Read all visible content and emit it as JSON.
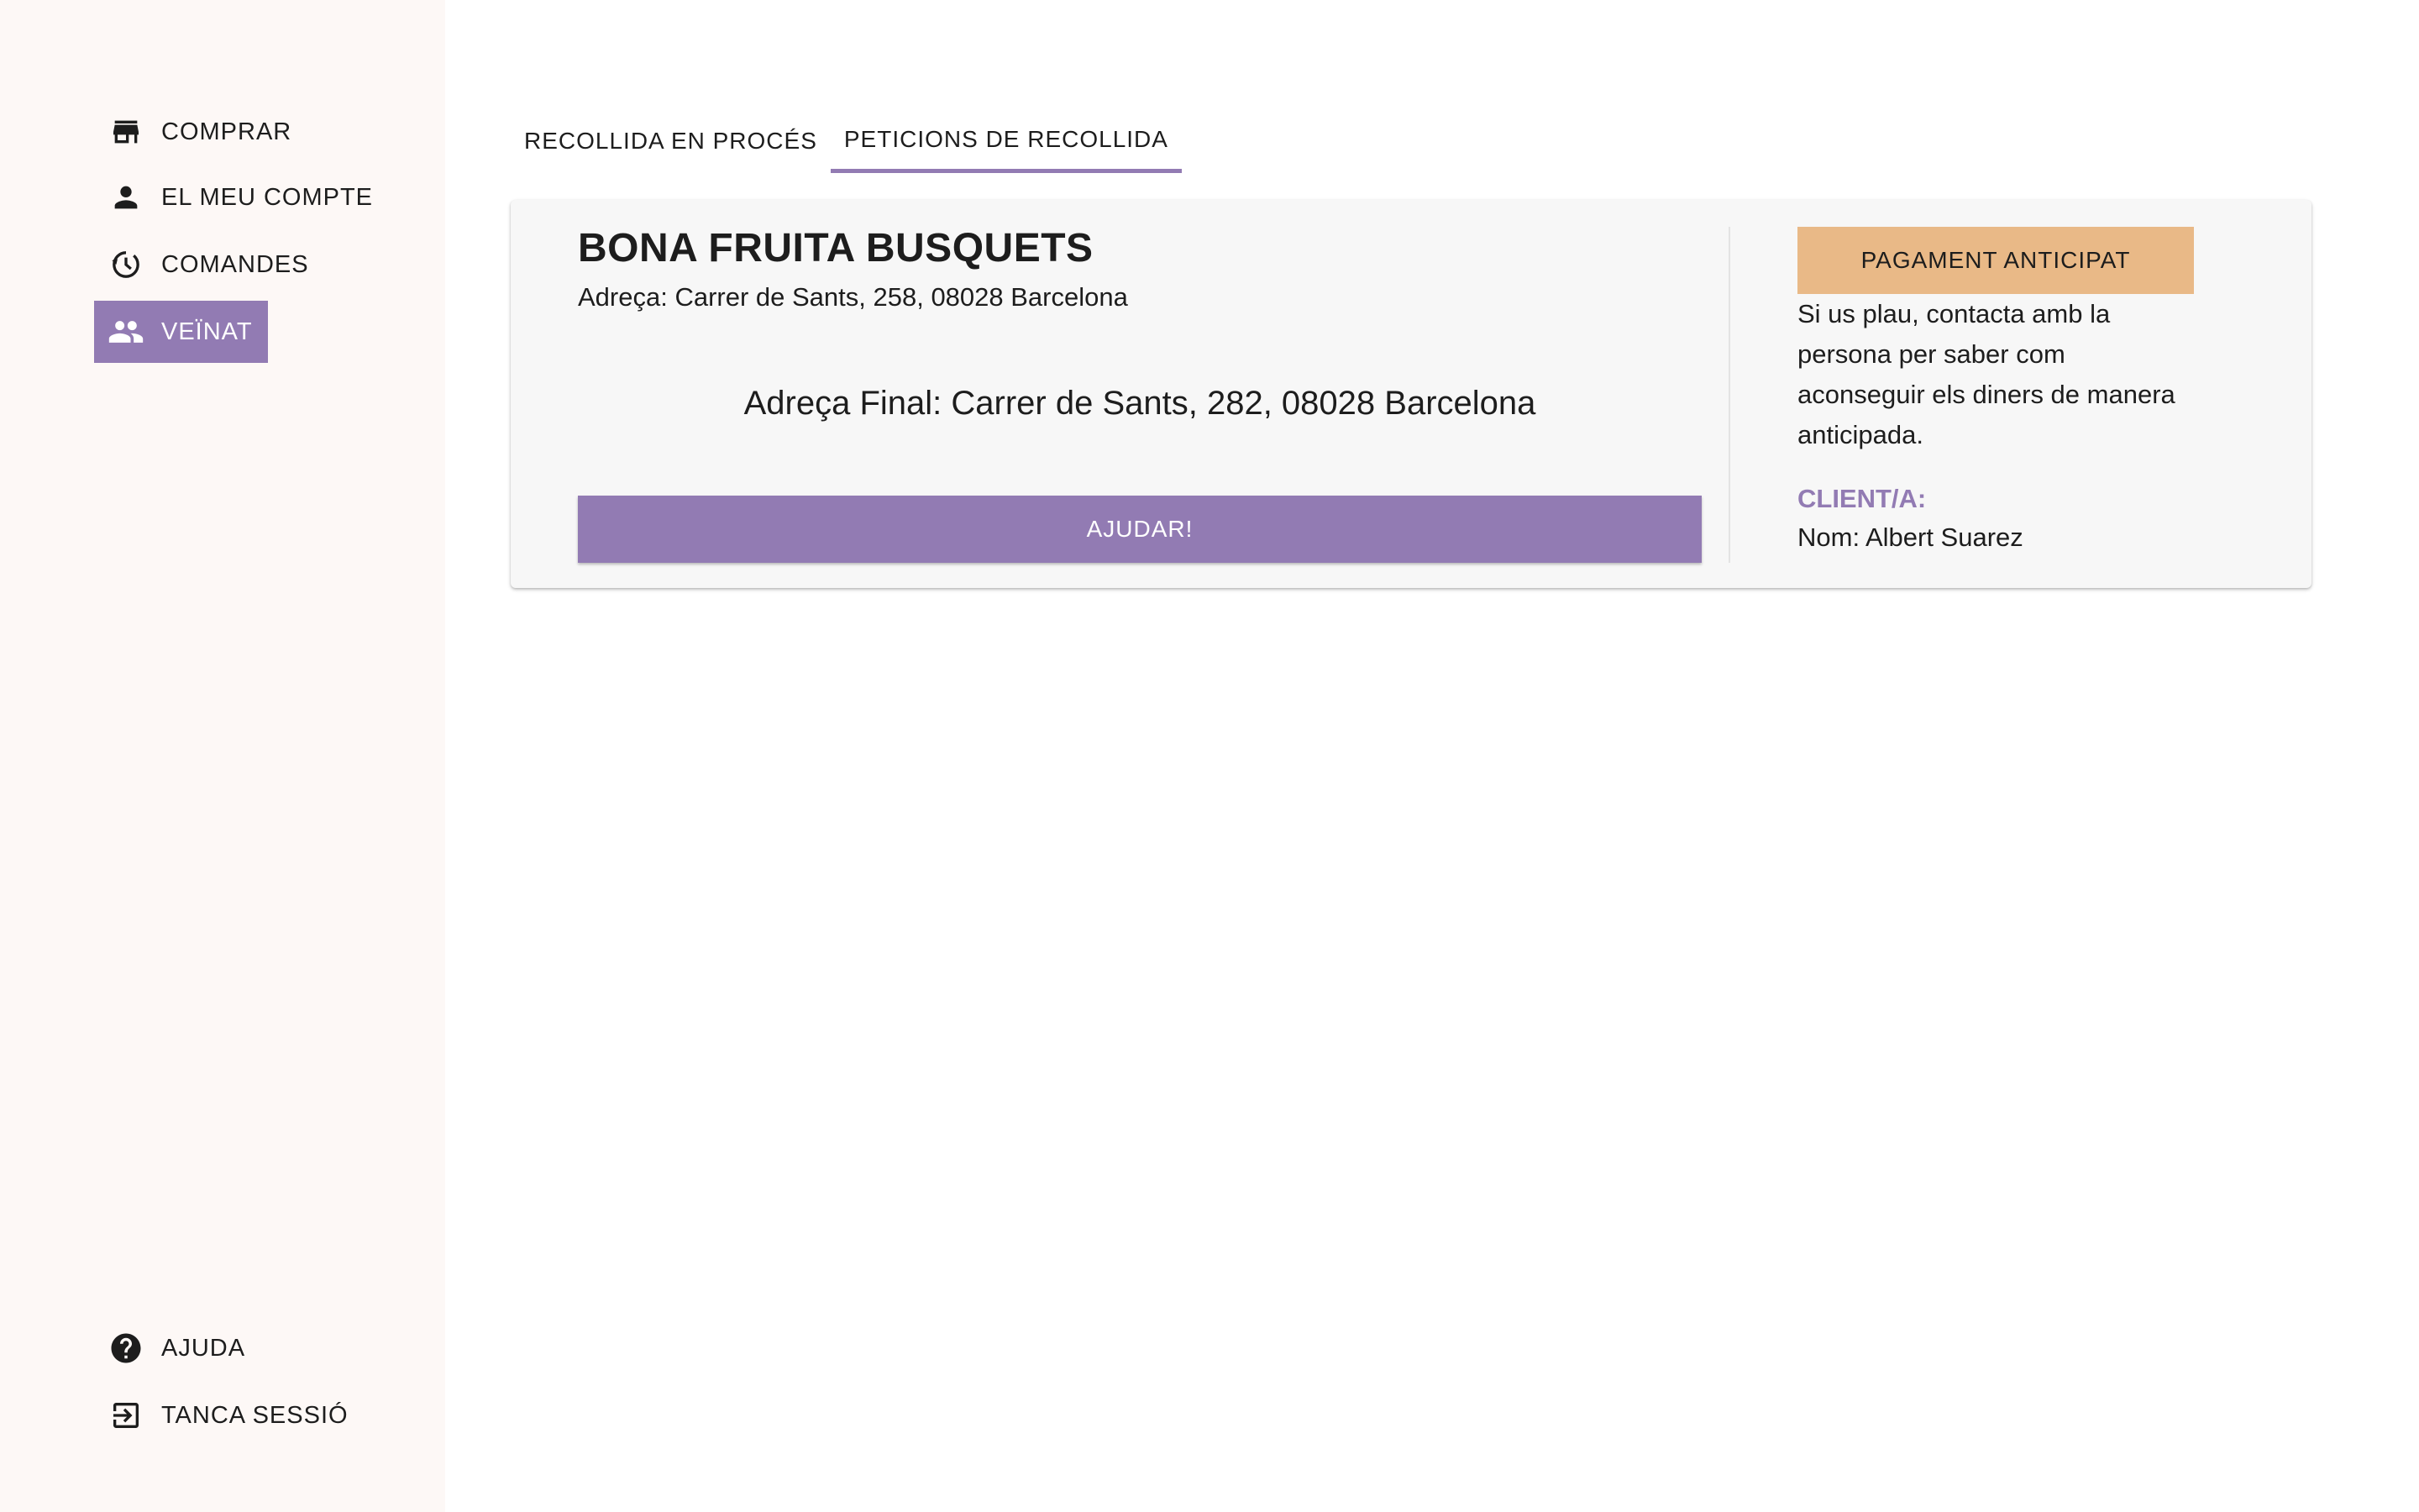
{
  "sidebar": {
    "items": [
      {
        "label": "COMPRAR",
        "icon": "store-icon"
      },
      {
        "label": "EL MEU COMPTE",
        "icon": "person-icon"
      },
      {
        "label": "COMANDES",
        "icon": "history-icon"
      },
      {
        "label": "VEÏNAT",
        "icon": "people-icon"
      }
    ],
    "bottom_items": [
      {
        "label": "AJUDA",
        "icon": "help-icon"
      },
      {
        "label": "TANCA SESSIÓ",
        "icon": "logout-icon"
      }
    ],
    "active_item": "VEÏNAT"
  },
  "tabs": [
    {
      "label": "RECOLLIDA EN PROCÉS"
    },
    {
      "label": "PETICIONS DE RECOLLIDA"
    }
  ],
  "active_tab": "PETICIONS DE RECOLLIDA",
  "request": {
    "shop_name": "BONA FRUITA BUSQUETS",
    "shop_address": "Adreça: Carrer de Sants, 258, 08028 Barcelona",
    "final_address": "Adreça Final: Carrer de Sants, 282, 08028 Barcelona",
    "help_button": "AJUDAR!",
    "payment_badge": "PAGAMENT ANTICIPAT",
    "payment_note": "Si us plau, contacta amb la persona per saber com aconseguir els diners de manera anticipada.",
    "client_heading": "CLIENT/A:",
    "client_name": "Nom: Albert Suarez"
  },
  "colors": {
    "accent": "#927bb3",
    "sidebar_bg": "#fdf8f6",
    "badge": "#e9b987",
    "card_bg": "#f7f7f7"
  }
}
